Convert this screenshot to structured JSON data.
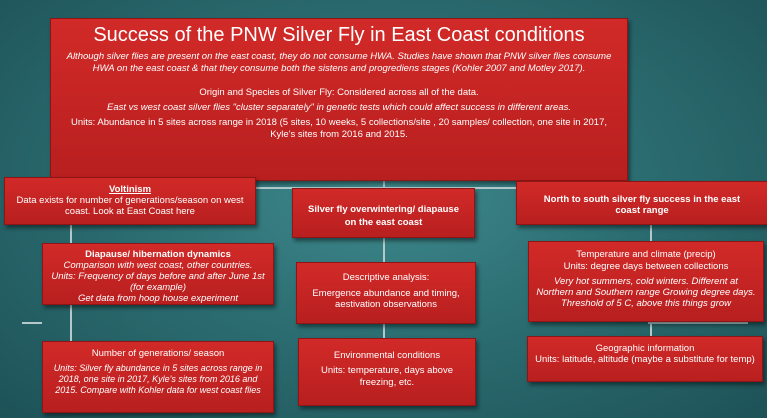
{
  "main": {
    "title": "Success of the PNW Silver Fly in East Coast conditions",
    "intro": "Although silver flies are present on the east coast, they do not consume HWA. Studies have shown that PNW silver flies consume HWA on the east coast & that they consume both the sistens and progrediens stages (Kohler 2007 and Motley 2017).",
    "origin": "Origin and Species of Silver Fly: Considered across all of the data.",
    "cluster": "East vs west coast silver flies \"cluster separately\" in genetic tests which could affect success in different areas.",
    "units": "Units: Abundance in 5 sites across range in 2018 (5 sites, 10 weeks, 5 collections/site , 20 samples/ collection, one site in 2017, Kyle's sites from 2016 and 2015."
  },
  "voltinism": {
    "title": "Voltinism",
    "text": "Data exists for number of generations/season on west coast.  Look at East Coast here"
  },
  "overwintering": {
    "text": "Silver fly overwintering/ diapause on the east coast"
  },
  "north_south": {
    "text": "North to south silver fly success in the east coast range"
  },
  "diapause": {
    "title": "Diapause/ hibernation dynamics",
    "line1": "Comparison with west coast, other countries.",
    "line2": "Units: Frequency of days before and after June 1st (for example)",
    "line3": "Get data from hoop house experiment"
  },
  "descriptive": {
    "title": "Descriptive analysis:",
    "text": "Emergence abundance and timing, aestivation observations"
  },
  "temperature": {
    "title": "Temperature and climate (precip)",
    "units": "Units: degree days between collections",
    "text": "Very hot summers, cold winters.  Different at Northern and Southern range Growing degree days. Threshold of 5 C, above this things grow"
  },
  "generations": {
    "title": "Number of generations/ season",
    "text": "Units:  Silver fly abundance in 5 sites across range in 2018, one site in 2017, Kyle's sites from 2016 and 2015.  Compare with Kohler data for west coast flies"
  },
  "environmental": {
    "title": "Environmental conditions",
    "text": "Units: temperature, days above freezing, etc."
  },
  "geographic": {
    "title": "Geographic information",
    "text": "Units: latitude, altitude (maybe a substitute for temp)"
  }
}
